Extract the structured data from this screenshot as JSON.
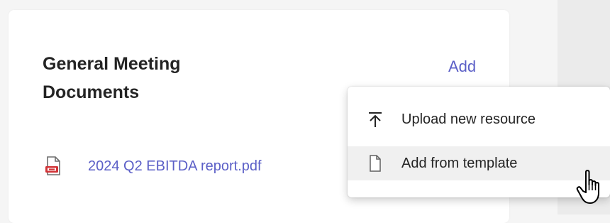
{
  "card": {
    "title": "General Meeting Documents",
    "add_label": "Add",
    "files": [
      {
        "name": "2024 Q2 EBITDA report.pdf",
        "icon": "pdf-file-icon"
      }
    ]
  },
  "add_menu": {
    "items": [
      {
        "label": "Upload new resource",
        "icon": "upload-icon"
      },
      {
        "label": "Add from template",
        "icon": "document-icon"
      }
    ],
    "highlighted_index": 1
  },
  "colors": {
    "accent": "#5b5fc7",
    "pdf_red": "#d13438",
    "text": "#242424",
    "menu_hover": "#f0f0f0"
  },
  "cursor": "hand-pointer"
}
